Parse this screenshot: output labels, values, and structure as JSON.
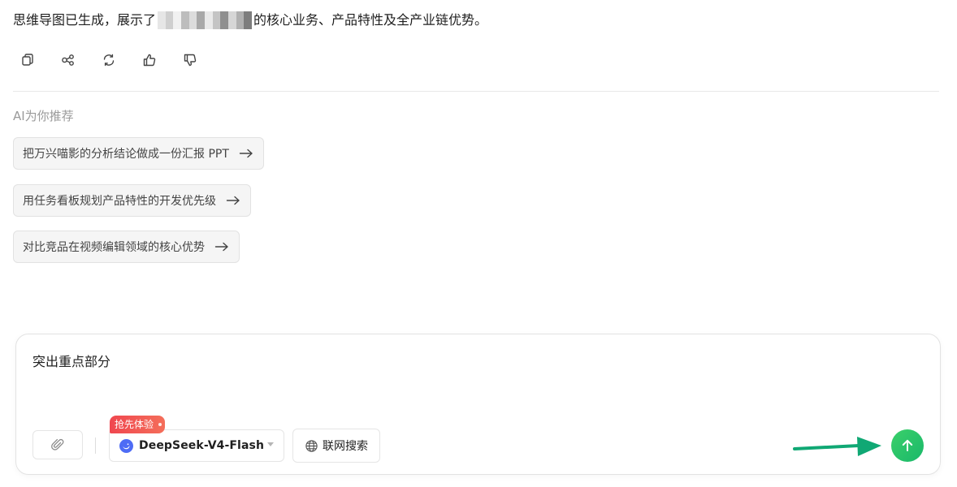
{
  "message": {
    "prefix": "思维导图已生成，展示了",
    "suffix": "的核心业务、产品特性及全产业链优势。"
  },
  "actions": {
    "copy": "copy-icon",
    "share": "share-icon",
    "regenerate": "refresh-icon",
    "like": "thumbs-up-icon",
    "dislike": "thumbs-down-icon"
  },
  "recommendations": {
    "title": "AI为你推荐",
    "items": [
      {
        "label": "把万兴喵影的分析结论做成一份汇报 PPT"
      },
      {
        "label": "用任务看板规划产品特性的开发优先级"
      },
      {
        "label": "对比竞品在视频编辑领域的核心优势"
      }
    ]
  },
  "composer": {
    "text": "突出重点部分",
    "attach_icon": "paperclip-icon",
    "promo_badge": "抢先体验",
    "model_name": "DeepSeek-V4-Flash",
    "web_search_label": "联网搜索",
    "send_icon": "arrow-up-icon"
  },
  "colors": {
    "send_button": "#23c46a",
    "annotation_arrow": "#10a874",
    "promo_badge": "#f0474f",
    "model_logo": "#4e6cf5"
  }
}
